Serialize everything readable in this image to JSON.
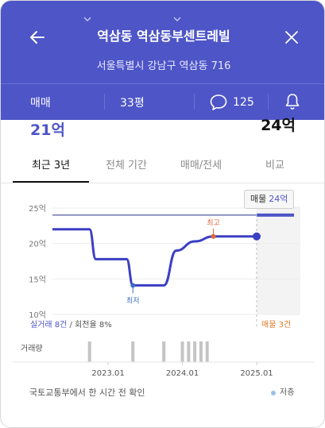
{
  "header": {
    "title": "역삼동 역삼동부센트레빌",
    "address": "서울특별시 강남구 역삼동 716",
    "deal_type": "매매",
    "size": "33평",
    "comment_count": "125",
    "background_color": "#4d55c7"
  },
  "prices": {
    "latest_trade": "21억",
    "listing": "24억"
  },
  "tabs": [
    {
      "label": "최근 3년",
      "active": true
    },
    {
      "label": "전체 기간",
      "active": false
    },
    {
      "label": "매매/전세",
      "active": false
    },
    {
      "label": "비교",
      "active": false
    }
  ],
  "listing_badge": {
    "prefix": "매물",
    "value": "24억"
  },
  "stats": {
    "trades": "실거래 8건",
    "separator": " / ",
    "turnover": "회전율 8%"
  },
  "listing_count": "매물 3건",
  "volume_label": "거래량",
  "source": "국토교통부에서 한 시간 전 확인",
  "legend_low": "저층",
  "chart_data": {
    "type": "line",
    "y_unit": "억",
    "ylim": [
      10,
      25
    ],
    "yticks": [
      {
        "value": 25,
        "label": "25억"
      },
      {
        "value": 20,
        "label": "20억"
      },
      {
        "value": 15,
        "label": "15억"
      },
      {
        "value": 10,
        "label": "10억"
      }
    ],
    "xticks": [
      "2023.01",
      "2024.01",
      "2025.01"
    ],
    "series": [
      {
        "values": [
          {
            "x": "2022-04",
            "y": 22.0
          },
          {
            "x": "2022-10",
            "y": 22.0
          },
          {
            "x": "2022-11",
            "y": 17.8
          },
          {
            "x": "2023-04",
            "y": 17.8
          },
          {
            "x": "2023-05",
            "y": 14.1
          },
          {
            "x": "2023-10",
            "y": 14.1
          },
          {
            "x": "2023-12",
            "y": 19.0
          },
          {
            "x": "2024-03",
            "y": 20.3
          },
          {
            "x": "2024-06",
            "y": 21.0
          },
          {
            "x": "2025-01",
            "y": 21.0
          }
        ]
      }
    ],
    "listing_price": 24,
    "annotations": [
      {
        "label": "최고",
        "x": "2024-06",
        "y": 21.0,
        "color": "#e0683a"
      },
      {
        "label": "최저",
        "x": "2023-05",
        "y": 14.1,
        "color": "#3a6fc6"
      }
    ],
    "trade_volume_months": [
      "2022-10",
      "2023-05",
      "2023-10",
      "2024-01",
      "2024-02",
      "2024-03",
      "2024-04",
      "2024-05"
    ],
    "line_color": "#3b3fc4"
  }
}
